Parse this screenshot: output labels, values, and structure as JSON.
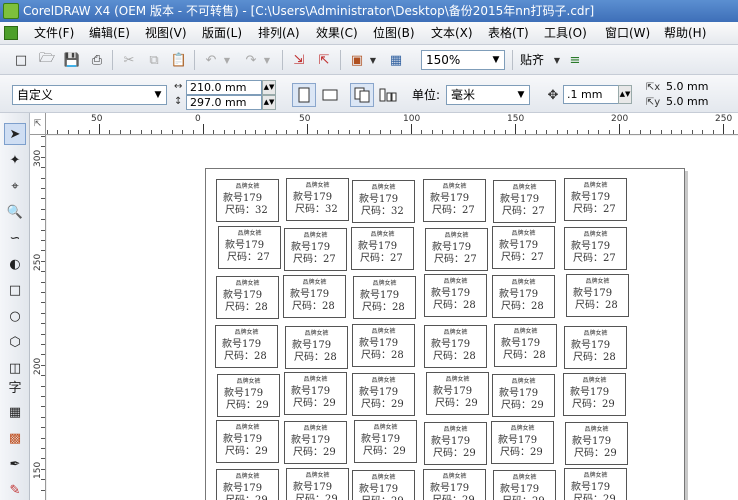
{
  "window": {
    "title": "CorelDRAW X4 (OEM 版本 - 不可转售) - [C:\\Users\\Administrator\\Desktop\\备份2015年nn打码子.cdr]"
  },
  "menu": [
    "文件(F)",
    "编辑(E)",
    "视图(V)",
    "版面(L)",
    "排列(A)",
    "效果(C)",
    "位图(B)",
    "文本(X)",
    "表格(T)",
    "工具(O)",
    "窗口(W)",
    "帮助(H)"
  ],
  "toolbar": {
    "zoom": "150%",
    "snap_label": "贴齐"
  },
  "property_bar": {
    "preset": "自定义",
    "width": "210.0 mm",
    "height": "297.0 mm",
    "units_label": "单位:",
    "units": "毫米",
    "nudge": ".1 mm",
    "dup_x": "5.0 mm",
    "dup_y": "5.0 mm"
  },
  "ruler_h_ticks": [
    "50",
    "0",
    "50",
    "100",
    "150",
    "200",
    "250"
  ],
  "ruler_v_ticks": [
    "300",
    "250",
    "200",
    "150"
  ],
  "labels": {
    "brand": "品牌女裤",
    "style": "款号179",
    "rows": [
      {
        "size": "尺码：32",
        "count": 3,
        "size2": "尺码：27",
        "count2": 3
      },
      {
        "size": "尺码：27",
        "count": 6
      },
      {
        "size": "尺码：28",
        "count": 6
      },
      {
        "size": "尺码：28",
        "count": 6
      },
      {
        "size": "尺码：29",
        "count": 6
      },
      {
        "size": "尺码：29",
        "count": 6
      }
    ]
  }
}
